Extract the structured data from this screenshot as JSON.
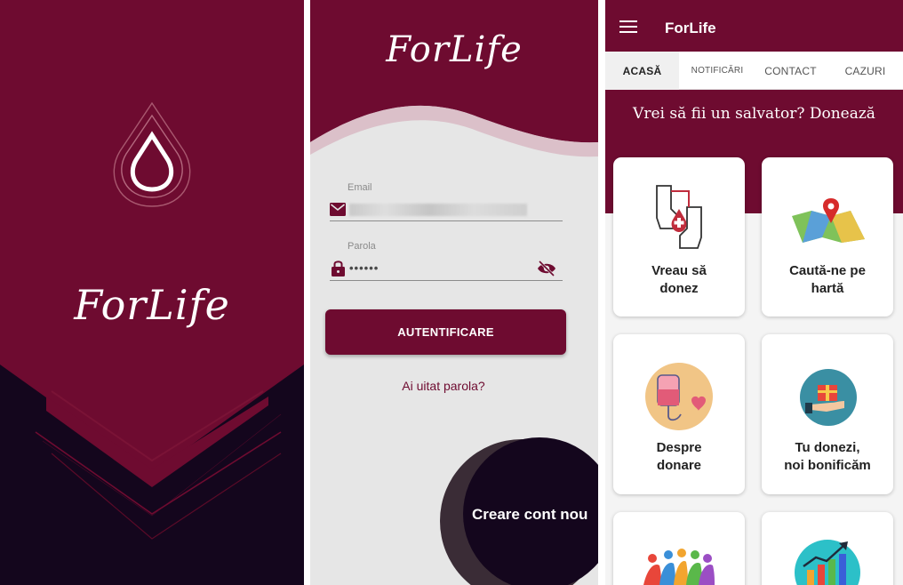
{
  "splash": {
    "logo_text": "ForLife",
    "colors": {
      "primary": "#6e0b30",
      "dark": "#14061d"
    },
    "icons": [
      "blood-drop-icon"
    ]
  },
  "login": {
    "logo_text": "ForLife",
    "email": {
      "label": "Email",
      "value": ""
    },
    "password": {
      "label": "Parola",
      "value": "••••••"
    },
    "login_button": "AUTENTIFICARE",
    "forgot_password": "Ai uitat parola?",
    "create_account": "Creare cont nou",
    "icons": [
      "mail-icon",
      "lock-icon",
      "eye-off-icon"
    ]
  },
  "home": {
    "app_title": "ForLife",
    "tabs": [
      {
        "label": "ACASĂ"
      },
      {
        "label": "NOTIFICĂRI"
      },
      {
        "label": "CONTACT"
      },
      {
        "label": "CAZURI"
      }
    ],
    "hero_text": "Vrei să fii un salvator? Donează",
    "cards": [
      {
        "line1": "Vreau să",
        "line2": "donez",
        "icon": "donate-hands-icon"
      },
      {
        "line1": "Caută-ne pe",
        "line2": "hartă",
        "icon": "map-pin-icon"
      },
      {
        "line1": "Despre",
        "line2": "donare",
        "icon": "blood-bag-icon"
      },
      {
        "line1": "Tu donezi,",
        "line2": "noi bonificăm",
        "icon": "gift-hand-icon"
      },
      {
        "line1": "",
        "line2": "",
        "icon": "community-icon"
      },
      {
        "line1": "",
        "line2": "",
        "icon": "growth-chart-icon"
      }
    ],
    "colors": {
      "primary": "#6e0b30",
      "background": "#f4f4f4"
    }
  }
}
